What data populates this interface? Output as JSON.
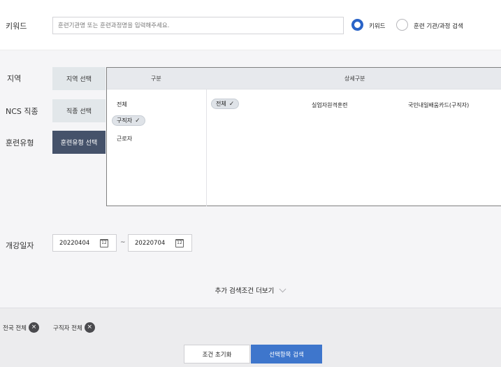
{
  "keyword": {
    "label": "키워드",
    "placeholder": "훈련기관명 또는 훈련과정명을 입력해주세요.",
    "radio_options": [
      "키워드",
      "훈련 기관/과정 검색"
    ],
    "selected_option": "키워드"
  },
  "filters": {
    "region": {
      "label": "지역",
      "button": "지역 선택"
    },
    "ncs": {
      "label": "NCS 직종",
      "button": "직종 선택"
    },
    "training_type": {
      "label": "훈련유형",
      "button": "훈련유형 선택"
    }
  },
  "dropdown": {
    "header_category": "구분",
    "header_detail": "상세구분",
    "categories": [
      "전체",
      "구직자",
      "근로자"
    ],
    "selected_category": "구직자",
    "details": [
      "전체",
      "실업자원격훈련",
      "국민내일배움카드(구직자)"
    ],
    "selected_detail": "전체",
    "check_mark": "✓"
  },
  "dates": {
    "label": "개강일자",
    "start": "20220404",
    "end": "20220704",
    "separator": "~",
    "calendar_glyph": "12"
  },
  "more_conditions": "추가 검색조건 더보기",
  "selected_tags": [
    "전국 전체",
    "구직자 전체"
  ],
  "tag_remove_glyph": "×",
  "buttons": {
    "reset": "조건 초기화",
    "search": "선택항목 검색"
  },
  "colors": {
    "accent": "#3e76cc",
    "radio_on": "#2a64c8",
    "active_filter": "#45526a"
  }
}
